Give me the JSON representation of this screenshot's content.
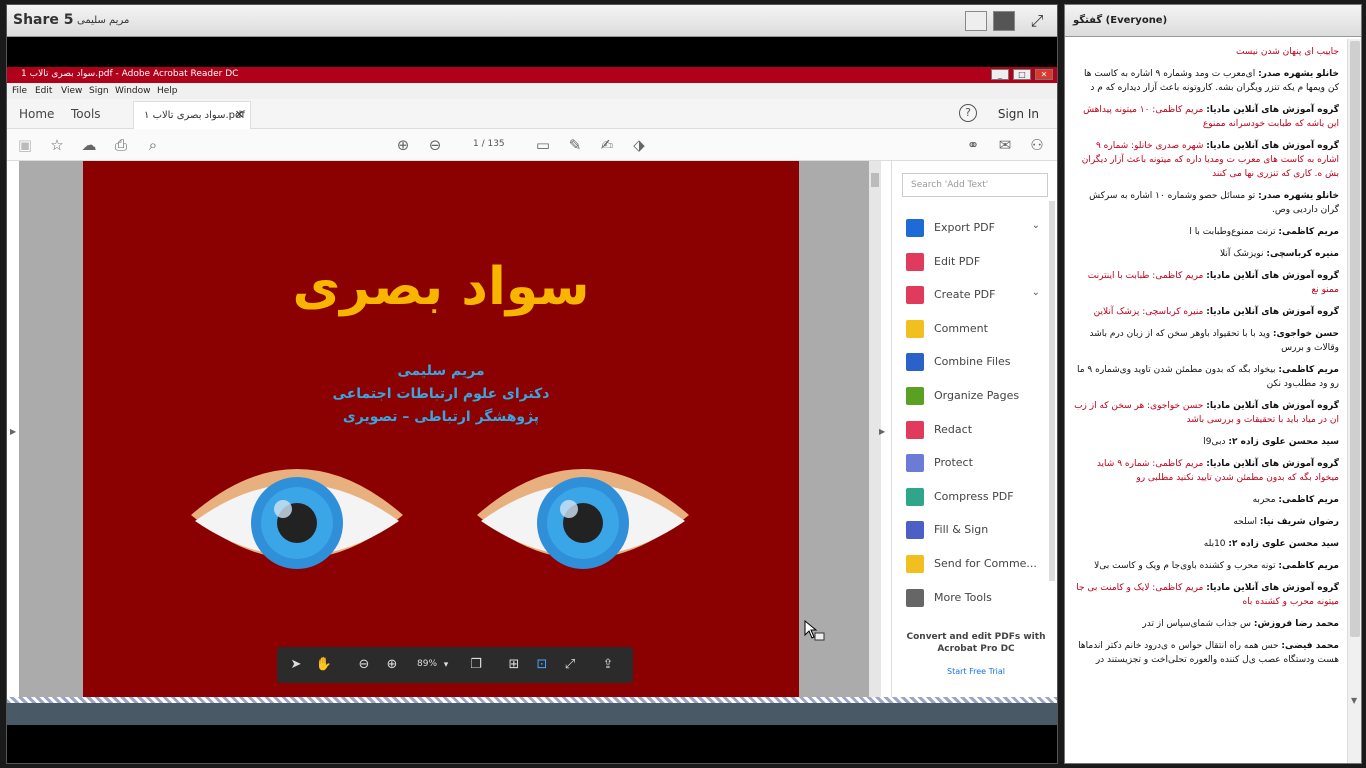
{
  "share_pod": {
    "title": "Share 5",
    "presenter": "مریم سلیمی"
  },
  "acrobat": {
    "window_title": "سواد بصری تالاب 1.pdf - Adobe Acrobat Reader DC",
    "window_controls": [
      "_",
      "□",
      "✕"
    ],
    "menu": [
      "File",
      "Edit",
      "View",
      "Sign",
      "Window",
      "Help"
    ],
    "tabs": {
      "home": "Home",
      "tools": "Tools",
      "doc_tab": "۱ سواد بصری تالاب.pdf"
    },
    "sign_in": "Sign In",
    "page_indicator": "1 / 135",
    "zoom": "89%",
    "search_placeholder": "Search 'Add Text'",
    "tools": [
      {
        "label": "Export PDF",
        "color": "#1f6bd6",
        "chevron": true
      },
      {
        "label": "Edit PDF",
        "color": "#e03a5c",
        "chevron": false
      },
      {
        "label": "Create PDF",
        "color": "#e03a5c",
        "chevron": true
      },
      {
        "label": "Comment",
        "color": "#f2c01e",
        "chevron": false
      },
      {
        "label": "Combine Files",
        "color": "#2a62c9",
        "chevron": false
      },
      {
        "label": "Organize Pages",
        "color": "#5aa021",
        "chevron": false
      },
      {
        "label": "Redact",
        "color": "#e03a5c",
        "chevron": false
      },
      {
        "label": "Protect",
        "color": "#6b7bd6",
        "chevron": false
      },
      {
        "label": "Compress PDF",
        "color": "#2fa58a",
        "chevron": false
      },
      {
        "label": "Fill & Sign",
        "color": "#4b5fc6",
        "chevron": false
      },
      {
        "label": "Send for Comme...",
        "color": "#f2c01e",
        "chevron": false
      },
      {
        "label": "More Tools",
        "color": "#666666",
        "chevron": false
      }
    ],
    "promo": "Convert and edit PDFs with Acrobat Pro DC",
    "trial": "Start Free Trial"
  },
  "pdf": {
    "title": "سواد بصری",
    "author": "مریم سلیمی",
    "degree": "دکترای علوم ارتباطات اجتماعی",
    "role": "پژوهشگر ارتباطی – تصویری",
    "bg": "#8b0000",
    "title_color": "#f7b500",
    "text_color": "#3aa6e0"
  },
  "chat": {
    "title": "گفتگو  (Everyone)",
    "messages": [
      {
        "color": "red",
        "sender": "",
        "text": "جاییب ای پنهان شدن نیست"
      },
      {
        "color": "black",
        "sender": "خانلو یشهره صدر:",
        "text": "ای‌معرب ت ومد وشماره ۹ اشاره به کاست ها کن ویمها م یکه تنزر ویگران بشه. کاروتونه باعث آزار دیداره که م د"
      },
      {
        "color": "red",
        "sender": "گروه آموزش های آنلاین مادیا:",
        "text": "مریم کاظمی: ۱۰ میتونه پیداهش این باشه که طبابت خودسرانه ممنوع"
      },
      {
        "color": "red",
        "sender": "گروه آموزش های آنلاین مادیا:",
        "text": "شهره صدری خانلو: شماره ۹ اشاره به کاست های معرب ت ومدیا داره که میتونه باعث آزار دیگران بش ه. کاری که تنزری نها می کنند"
      },
      {
        "color": "black",
        "sender": "خانلو یشهره صدر:",
        "text": "تو مسائل حصو وشماره ۱۰ اشاره به سرکش گران داردیی وص."
      },
      {
        "color": "black",
        "sender": "مریم کاظمی:",
        "text": "ترنت ممنوع‌وطبابت با ا"
      },
      {
        "color": "black",
        "sender": "منیره کرباسچی:",
        "text": "نویزشک آنلا"
      },
      {
        "color": "red",
        "sender": "گروه آموزش های آنلاین مادیا:",
        "text": "مریم کاظمی: طبابت با اینترنت ممنو نع"
      },
      {
        "color": "red",
        "sender": "گروه آموزش های آنلاین مادیا:",
        "text": "منیره کرباسچی: پزشک آنلاین"
      },
      {
        "color": "black",
        "sender": "حسن خواجوی:",
        "text": "وید با با تحقیواد باوهر سخن که از زبان درم باشد وقالات و بررس"
      },
      {
        "color": "black",
        "sender": "مریم کاظمی:",
        "text": "بیخواد بگه که بدون مطمئن شدن تاوید وی‌شماره ۹ ما رو ود مطلب‌ود نکن"
      },
      {
        "color": "red",
        "sender": "گروه آموزش های آنلاین مادیا:",
        "text": "حسن خواجوی: هر سخن که از زب ان در میاد باید با تحقیقات و بررسی باشد"
      },
      {
        "color": "black",
        "sender": "سید محسن علوی زاده ۲:",
        "text": "دبی9ا"
      },
      {
        "color": "red",
        "sender": "گروه آموزش های آنلاین مادیا:",
        "text": "مریم کاظمی: شماره ۹ شاید میخواد بگه که بدون مطمئن شدن تایید نکنید مطلبی رو"
      },
      {
        "color": "black",
        "sender": "مریم کاظمی:",
        "text": "محربه"
      },
      {
        "color": "black",
        "sender": "رضوان شریف نیا:",
        "text": "اسلحه"
      },
      {
        "color": "black",
        "sender": "سید محسن علوی زاده ۲:",
        "text": "10بله"
      },
      {
        "color": "black",
        "sender": "مریم کاظمی:",
        "text": "تونه محرب و کشنده باوی‌جا م ویک و کاست بی‌لا"
      },
      {
        "color": "red",
        "sender": "گروه آموزش های آنلاین مادیا:",
        "text": "مریم کاظمی: لایک و کامنت بی جا میتونه محرب و کشنده باه"
      },
      {
        "color": "black",
        "sender": "محمد رضا فروزش:",
        "text": "س جذاب شمای‌سپاس از تدر"
      },
      {
        "color": "black",
        "sender": "محمد فیضی:",
        "text": "حس همه راه انتقال حواس ه ی‌درود خانم دکتر اندماها هست و‌دستگاه عصب ی‌ل کننده والعوره تحلی‌اخت و تجزیستند در"
      }
    ]
  }
}
